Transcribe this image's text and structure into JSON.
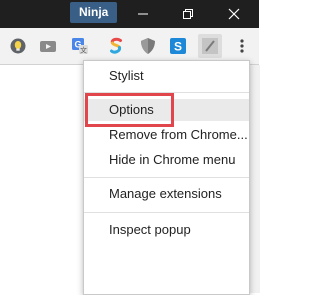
{
  "titlebar": {
    "profile_badge": "Ninja"
  },
  "toolbar": {
    "extensions": [
      {
        "icon": "lightbulb-extension-icon"
      },
      {
        "icon": "video-extension-icon"
      },
      {
        "icon": "google-translate-extension-icon"
      },
      {
        "icon": "colorful-s-extension-icon"
      },
      {
        "icon": "shield-extension-icon"
      },
      {
        "icon": "blue-s-extension-icon"
      },
      {
        "icon": "stylist-extension-icon"
      }
    ],
    "menu_button": {
      "icon": "three-dots-menu-icon"
    }
  },
  "context_menu": {
    "items": [
      {
        "label": "Stylist"
      },
      {
        "label": "Options"
      },
      {
        "label": "Remove from Chrome..."
      },
      {
        "label": "Hide in Chrome menu"
      },
      {
        "label": "Manage extensions"
      },
      {
        "label": "Inspect popup"
      }
    ],
    "highlighted_item": "Options"
  },
  "colors": {
    "titlebar": "#1f1f1f",
    "badge": "#3a5f86",
    "highlight_outline": "#e0464b",
    "menu_hover": "#eaeaea"
  }
}
